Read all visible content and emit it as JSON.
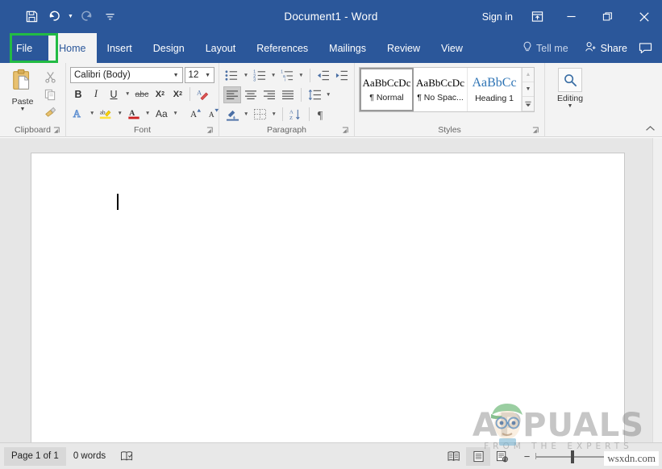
{
  "titlebar": {
    "document_title": "Document1  -  Word",
    "signin_label": "Sign in",
    "quick_access": [
      {
        "name": "save-icon",
        "label": "Save",
        "state": "enabled"
      },
      {
        "name": "undo-icon",
        "label": "Undo",
        "state": "enabled"
      },
      {
        "name": "redo-icon",
        "label": "Redo",
        "state": "disabled"
      },
      {
        "name": "customize-qat-icon",
        "label": "Customize Quick Access Toolbar",
        "state": "enabled"
      }
    ],
    "window_buttons": [
      {
        "name": "ribbon-display-options-icon",
        "label": "Ribbon Display Options",
        "glyph": "ribbon"
      },
      {
        "name": "minimize-button",
        "label": "Minimize",
        "glyph": "minimize"
      },
      {
        "name": "restore-button",
        "label": "Restore Down",
        "glyph": "restore"
      },
      {
        "name": "close-button",
        "label": "Close",
        "glyph": "close"
      }
    ]
  },
  "tabs": [
    {
      "label": "File",
      "active": false,
      "highlighted": true
    },
    {
      "label": "Home",
      "active": true,
      "highlighted": false
    },
    {
      "label": "Insert",
      "active": false,
      "highlighted": false
    },
    {
      "label": "Design",
      "active": false,
      "highlighted": false
    },
    {
      "label": "Layout",
      "active": false,
      "highlighted": false
    },
    {
      "label": "References",
      "active": false,
      "highlighted": false
    },
    {
      "label": "Mailings",
      "active": false,
      "highlighted": false
    },
    {
      "label": "Review",
      "active": false,
      "highlighted": false
    },
    {
      "label": "View",
      "active": false,
      "highlighted": false
    }
  ],
  "tab_right": {
    "tellme_label": "Tell me",
    "share_label": "Share",
    "comments_name": "comments-icon"
  },
  "ribbon": {
    "groups": [
      {
        "label": "Clipboard",
        "has_launcher": true
      },
      {
        "label": "Font",
        "has_launcher": true
      },
      {
        "label": "Paragraph",
        "has_launcher": true
      },
      {
        "label": "Styles",
        "has_launcher": true
      },
      {
        "label": "Editing",
        "has_launcher": false
      }
    ],
    "clipboard": {
      "paste_label": "Paste",
      "items": [
        {
          "name": "cut-icon",
          "label": "Cut"
        },
        {
          "name": "copy-icon",
          "label": "Copy"
        },
        {
          "name": "format-painter-icon",
          "label": "Format Painter"
        }
      ]
    },
    "font": {
      "font_name": "Calibri (Body)",
      "font_size": "12",
      "buttons": [
        {
          "name": "bold-button",
          "label": "B"
        },
        {
          "name": "italic-button",
          "label": "I"
        },
        {
          "name": "underline-button",
          "label": "U"
        },
        {
          "name": "strikethrough-button",
          "label": "abc"
        },
        {
          "name": "subscript-button",
          "label": "X"
        },
        {
          "name": "superscript-button",
          "label": "X"
        },
        {
          "name": "clear-formatting-button",
          "label": "Clear All Formatting"
        },
        {
          "name": "text-effects-button",
          "label": "A"
        },
        {
          "name": "text-highlight-button",
          "label": "ab"
        },
        {
          "name": "font-color-button",
          "label": "A"
        },
        {
          "name": "change-case-button",
          "label": "Aa"
        },
        {
          "name": "grow-font-button",
          "label": "A"
        },
        {
          "name": "shrink-font-button",
          "label": "A"
        }
      ]
    },
    "paragraph": {
      "buttons": [
        {
          "name": "bullets-button",
          "label": "Bullets"
        },
        {
          "name": "numbering-button",
          "label": "Numbering"
        },
        {
          "name": "multilevel-list-button",
          "label": "Multilevel List"
        },
        {
          "name": "decrease-indent-button",
          "label": "Decrease Indent"
        },
        {
          "name": "increase-indent-button",
          "label": "Increase Indent"
        },
        {
          "name": "align-left-button",
          "label": "Align Left",
          "selected": true
        },
        {
          "name": "align-center-button",
          "label": "Center"
        },
        {
          "name": "align-right-button",
          "label": "Align Right"
        },
        {
          "name": "justify-button",
          "label": "Justify"
        },
        {
          "name": "line-spacing-button",
          "label": "Line and Paragraph Spacing"
        },
        {
          "name": "shading-button",
          "label": "Shading"
        },
        {
          "name": "borders-button",
          "label": "Borders"
        },
        {
          "name": "sort-button",
          "label": "Sort"
        },
        {
          "name": "show-formatting-marks-button",
          "label": "Show/Hide"
        }
      ]
    },
    "styles": {
      "items": [
        {
          "preview": "AaBbCcDc",
          "name": "¶ Normal",
          "selected": true,
          "heading": false
        },
        {
          "preview": "AaBbCcDc",
          "name": "¶ No Spac...",
          "selected": false,
          "heading": false
        },
        {
          "preview": "AaBbCc",
          "name": "Heading 1",
          "selected": false,
          "heading": true
        }
      ],
      "scroll": [
        {
          "name": "styles-scroll-up-button",
          "glyph": "▲",
          "disabled": true
        },
        {
          "name": "styles-scroll-down-button",
          "glyph": "▼",
          "disabled": false
        },
        {
          "name": "styles-more-button",
          "glyph": "▼",
          "disabled": false
        }
      ]
    },
    "editing": {
      "label": "Editing",
      "icon": "find-magnifier-icon"
    },
    "collapse_label": "Collapse the Ribbon"
  },
  "statusbar": {
    "page_info": "Page 1 of 1",
    "word_count": "0 words",
    "proofing_icon": "proofing-errors-icon",
    "views": [
      {
        "name": "read-mode-button",
        "label": "Read Mode",
        "active": false
      },
      {
        "name": "print-layout-button",
        "label": "Print Layout",
        "active": true
      },
      {
        "name": "web-layout-button",
        "label": "Web Layout",
        "active": false
      }
    ],
    "zoom_out_label": "−",
    "zoom_in_label": "+",
    "zoom_value": "90%"
  },
  "watermark": {
    "main_text": "APPUALS",
    "sub_text": "FROM THE EXPERTS",
    "url_text": "wsxdn.com"
  },
  "colors": {
    "word_blue": "#2b579a",
    "highlight_green": "#22bb44",
    "ribbon_bg": "#f3f3f3",
    "doc_bg": "#e6e6e6",
    "status_bg": "#e8e8e8",
    "heading_blue": "#2e74b5"
  }
}
